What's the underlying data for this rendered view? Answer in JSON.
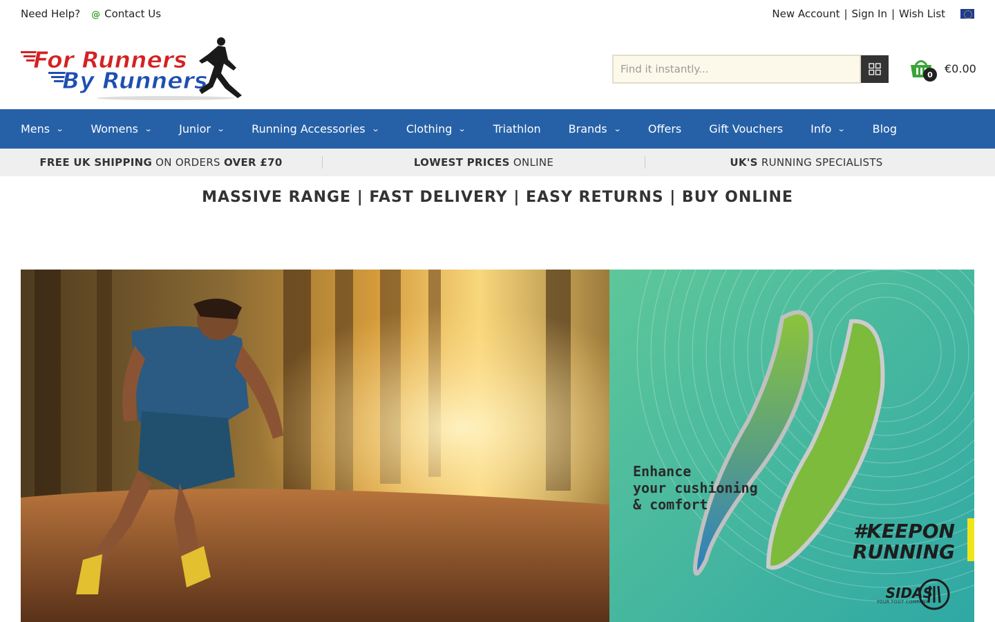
{
  "topbar": {
    "help": "Need Help?",
    "contact": "Contact Us",
    "new_account": "New Account",
    "sign_in": "Sign In",
    "wish_list": "Wish List",
    "sep": "|"
  },
  "logo": {
    "line1": "For Runners",
    "line2": "By Runners"
  },
  "search": {
    "placeholder": "Find it instantly..."
  },
  "cart": {
    "count": "0",
    "total": "€0.00"
  },
  "nav": {
    "items": [
      {
        "label": "Mens",
        "dropdown": true
      },
      {
        "label": "Womens",
        "dropdown": true
      },
      {
        "label": "Junior",
        "dropdown": true
      },
      {
        "label": "Running Accessories",
        "dropdown": true
      },
      {
        "label": "Clothing",
        "dropdown": true
      },
      {
        "label": "Triathlon",
        "dropdown": false
      },
      {
        "label": "Brands",
        "dropdown": true
      },
      {
        "label": "Offers",
        "dropdown": false
      },
      {
        "label": "Gift Vouchers",
        "dropdown": false
      },
      {
        "label": "Info",
        "dropdown": true
      },
      {
        "label": "Blog",
        "dropdown": false
      }
    ]
  },
  "usp": [
    {
      "bold1": "FREE UK SHIPPING",
      "normal": " ON ORDERS ",
      "bold2": "OVER £70"
    },
    {
      "bold1": "LOWEST PRICES",
      "normal": " ONLINE",
      "bold2": ""
    },
    {
      "bold1": "UK'S",
      "normal": " RUNNING SPECIALISTS",
      "bold2": ""
    }
  ],
  "tagline": "MASSIVE RANGE | FAST DELIVERY | EASY RETURNS | BUY ONLINE",
  "promo": {
    "line1": "Enhance",
    "line2": "your cushioning",
    "line3": "& comfort",
    "hashtag1": "#KEEPON",
    "hashtag2": "RUNNING",
    "brand": "SIDAS",
    "brand_sub": "YOUR FOOT COMPANY"
  },
  "colors": {
    "nav_bg": "#2661a8",
    "usp_bg": "#efefef",
    "accent_green": "#3aa537"
  }
}
